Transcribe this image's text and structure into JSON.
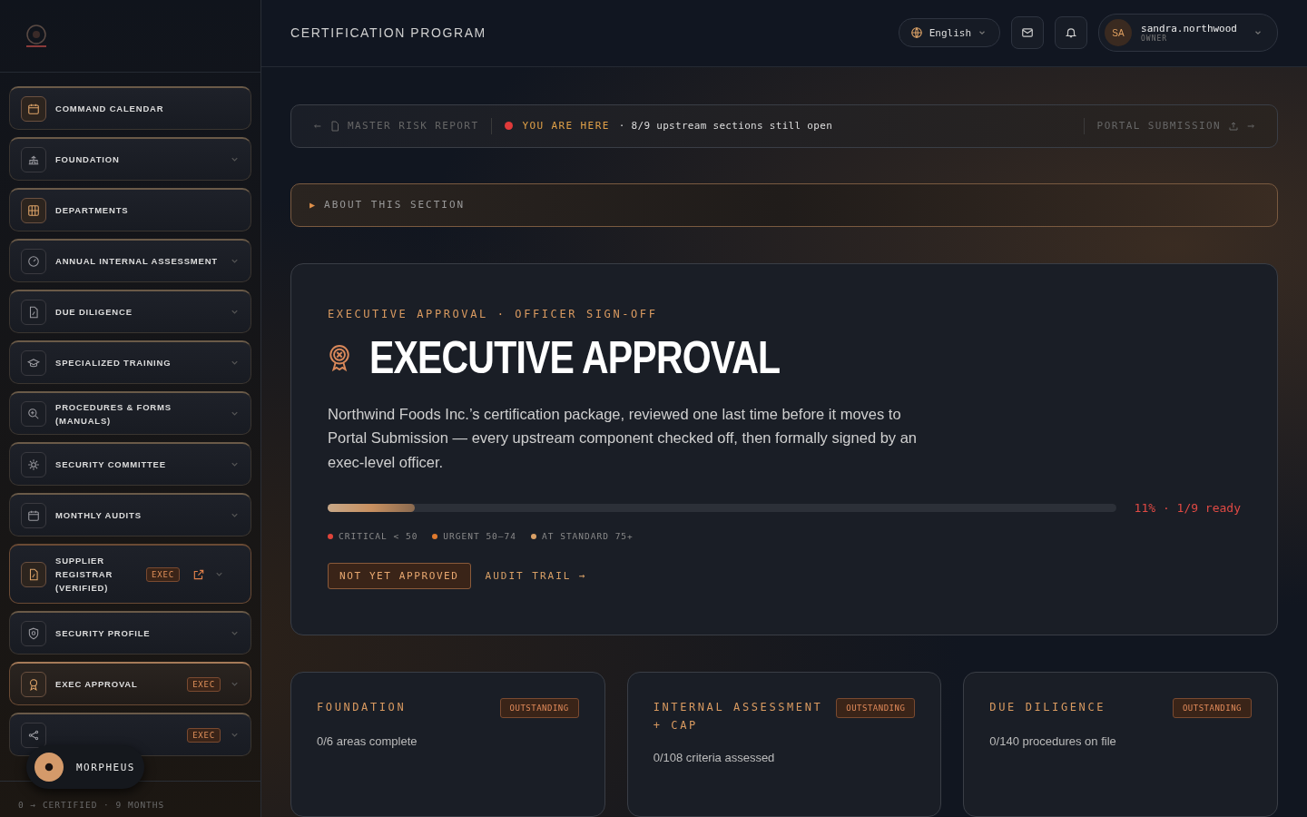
{
  "sidebar": {
    "items": [
      {
        "label": "COMMAND CALENDAR",
        "kind": "link",
        "selected": false,
        "accent": true
      },
      {
        "label": "FOUNDATION",
        "kind": "group",
        "selected": false,
        "accent": false
      },
      {
        "label": "DEPARTMENTS",
        "kind": "link",
        "selected": false,
        "accent": true
      },
      {
        "label": "ANNUAL INTERNAL ASSESSMENT",
        "kind": "group",
        "selected": false,
        "accent": false
      },
      {
        "label": "DUE DILIGENCE",
        "kind": "group",
        "selected": false,
        "accent": false
      },
      {
        "label": "SPECIALIZED TRAINING",
        "kind": "group",
        "selected": false,
        "accent": false
      },
      {
        "label": "PROCEDURES & FORMS (MANUALS)",
        "kind": "group",
        "selected": false,
        "accent": false
      },
      {
        "label": "SECURITY COMMITTEE",
        "kind": "group",
        "selected": false,
        "accent": false
      },
      {
        "label": "MONTHLY AUDITS",
        "kind": "group",
        "selected": false,
        "accent": false
      },
      {
        "label": "SUPPLIER REGISTRAR (VERIFIED)",
        "kind": "group",
        "selected": false,
        "accent": true,
        "badge": "EXEC",
        "external": true
      },
      {
        "label": "SECURITY PROFILE",
        "kind": "group",
        "selected": false,
        "accent": false
      },
      {
        "label": "EXEC APPROVAL",
        "kind": "group",
        "selected": true,
        "accent": true,
        "badge": "EXEC"
      },
      {
        "kind": "group",
        "selected": false,
        "accent": false,
        "badge": "EXEC"
      }
    ],
    "assistant": "MORPHEUS",
    "footer": "0 → CERTIFIED · 9 MONTHS"
  },
  "header": {
    "title": "CERTIFICATION PROGRAM",
    "language": "English",
    "user": {
      "initials": "SA",
      "name": "sandra.northwood",
      "role": "OWNER"
    }
  },
  "breadcrumb": {
    "prev": "MASTER RISK REPORT",
    "current": "YOU ARE HERE",
    "note": "· 8/9 upstream sections still open",
    "next": "PORTAL SUBMISSION"
  },
  "about": {
    "marker": "▶",
    "label": "ABOUT THIS SECTION",
    "expanded": false
  },
  "hero": {
    "eyebrow": "EXECUTIVE APPROVAL · OFFICER SIGN-OFF",
    "title": "EXECUTIVE APPROVAL",
    "description": "Northwind Foods Inc.’s certification package, reviewed one last time before it moves to Portal Submission — every upstream component checked off, then formally signed by an exec-level officer.",
    "progress": {
      "level": 0.11,
      "reading": "11% · 1/9 ready"
    },
    "legend": [
      {
        "label": "CRITICAL < 50",
        "color": "#e0443a"
      },
      {
        "label": "URGENT 50–74",
        "color": "#e07a2e"
      },
      {
        "label": "AT STANDARD 75+",
        "color": "#d9a066"
      }
    ],
    "status": "NOT YET APPROVED",
    "link": "AUDIT TRAIL →"
  },
  "cards": [
    {
      "title": "FOUNDATION",
      "badge": "OUTSTANDING",
      "detail": "0/6 areas complete"
    },
    {
      "title": "INTERNAL ASSESSMENT + CAP",
      "badge": "OUTSTANDING",
      "detail": "0/108 criteria assessed"
    },
    {
      "title": "DUE DILIGENCE",
      "badge": "OUTSTANDING",
      "detail": "0/140 procedures on file"
    }
  ]
}
